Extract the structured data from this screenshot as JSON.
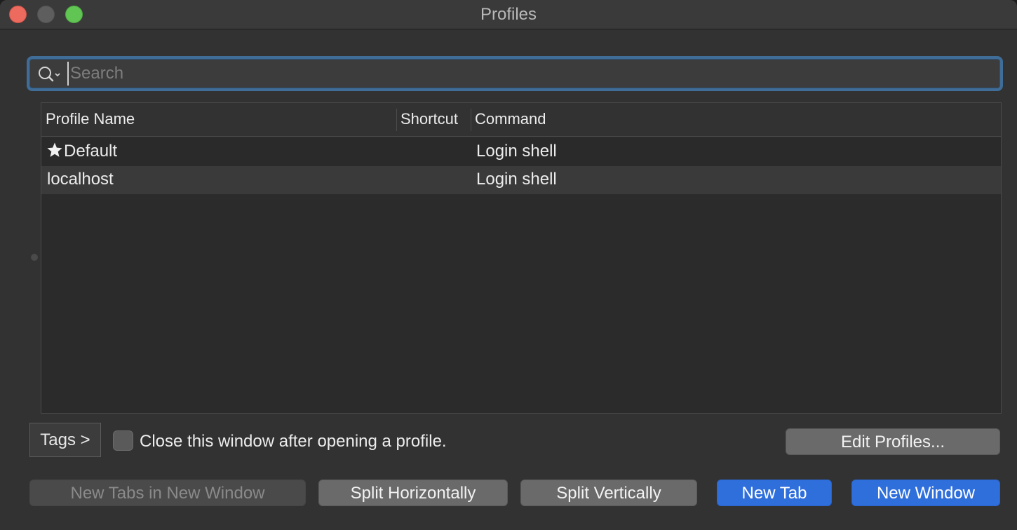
{
  "window": {
    "title": "Profiles"
  },
  "search": {
    "placeholder": "Search",
    "value": ""
  },
  "table": {
    "columns": [
      "Profile Name",
      "Shortcut",
      "Command"
    ],
    "rows": [
      {
        "name": "Default",
        "is_default": true,
        "shortcut": "",
        "command": "Login shell"
      },
      {
        "name": "localhost",
        "is_default": false,
        "shortcut": "",
        "command": "Login shell"
      }
    ]
  },
  "footer": {
    "tags_label": "Tags >",
    "close_after_open_label": "Close this window after opening a profile.",
    "close_after_open_checked": false,
    "edit_profiles_label": "Edit Profiles..."
  },
  "actions": {
    "new_tabs_in_new_window": "New Tabs in New Window",
    "split_horizontally": "Split Horizontally",
    "split_vertically": "Split Vertically",
    "new_tab": "New Tab",
    "new_window": "New Window"
  },
  "colors": {
    "primary_button": "#2f6fdc",
    "focus_ring": "#3f6d98",
    "close": "#ed6a5e",
    "zoom": "#61c554"
  },
  "icons": {
    "search": "search-icon",
    "default_profile": "star-icon"
  }
}
